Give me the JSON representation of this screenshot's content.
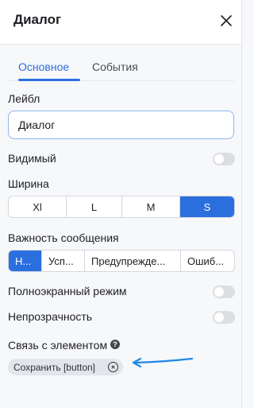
{
  "header": {
    "title": "Диалог"
  },
  "tabs": [
    {
      "label": "Основное",
      "active": true
    },
    {
      "label": "События",
      "active": false
    }
  ],
  "label_field": {
    "label": "Лейбл",
    "value": "Диалог"
  },
  "visible": {
    "label": "Видимый",
    "on": false
  },
  "width": {
    "label": "Ширина",
    "options": [
      "Xl",
      "L",
      "M",
      "S"
    ],
    "selected": "S"
  },
  "importance": {
    "label": "Важность сообщения",
    "options": [
      "Н...",
      "Усп...",
      "Предупрежде...",
      "Ошиб..."
    ],
    "selected": "Н..."
  },
  "fullscreen": {
    "label": "Полноэкранный режим",
    "on": false
  },
  "opacity": {
    "label": "Непрозрачность",
    "on": false
  },
  "link": {
    "label": "Связь с элементом",
    "chip": "Сохранить [button]"
  },
  "colors": {
    "accent": "#2b6fde",
    "toggle_off": "#dcdee3",
    "arrow": "#1e88e5"
  },
  "icons": {
    "close": "close-icon",
    "help": "help-icon",
    "chip_remove": "remove-circle-icon",
    "arrow": "arrow-icon"
  }
}
